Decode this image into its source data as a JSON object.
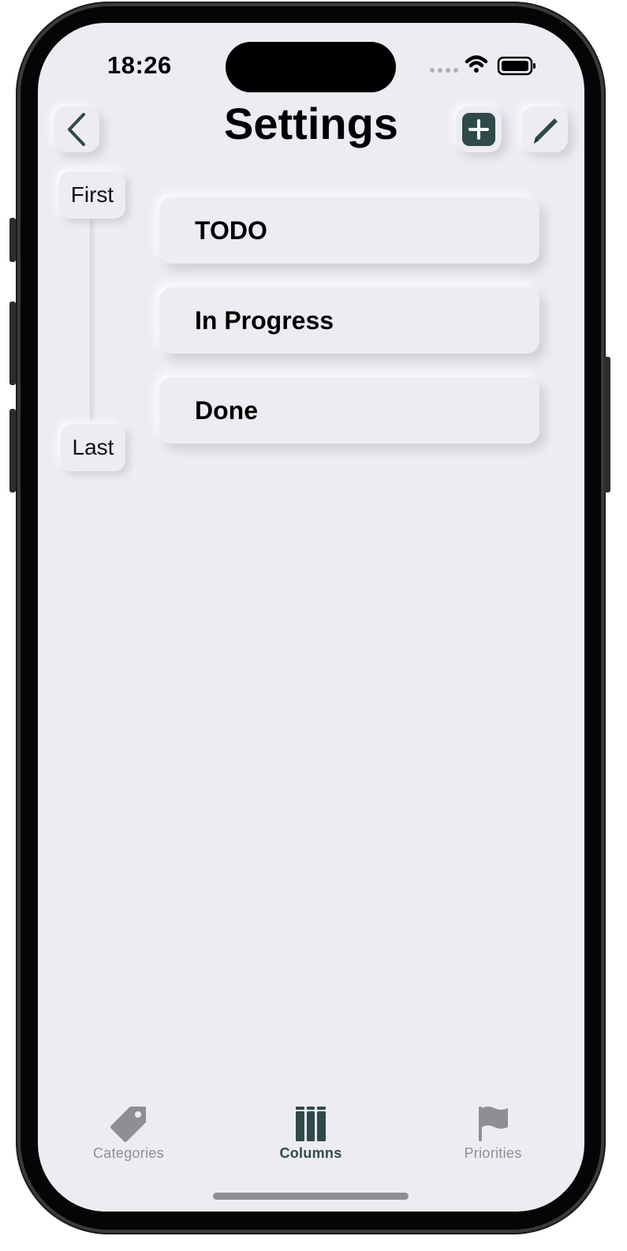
{
  "status_bar": {
    "time": "18:26"
  },
  "header": {
    "title": "Settings",
    "back_icon": "chevron-left-icon",
    "add_icon": "plus-icon",
    "edit_icon": "pencil-icon"
  },
  "order_slider": {
    "first_label": "First",
    "last_label": "Last"
  },
  "columns": [
    {
      "label": "TODO"
    },
    {
      "label": "In Progress"
    },
    {
      "label": "Done"
    }
  ],
  "tab_bar": {
    "tabs": [
      {
        "label": "Categories",
        "icon": "tag-icon",
        "selected": false
      },
      {
        "label": "Columns",
        "icon": "columns-icon",
        "selected": true
      },
      {
        "label": "Priorities",
        "icon": "flag-icon",
        "selected": false
      }
    ]
  },
  "colors": {
    "background": "#edecf2",
    "accent": "#2f4a4a",
    "inactive": "#8e8e93"
  }
}
